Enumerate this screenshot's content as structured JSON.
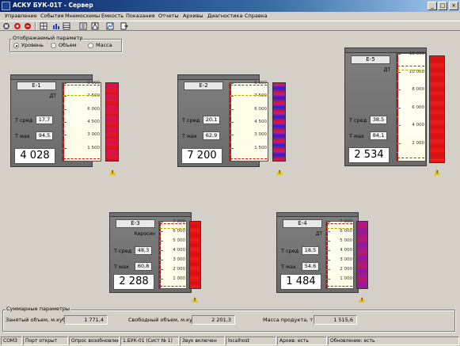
{
  "window": {
    "title": "АСКУ БУК-01Т - Сервер",
    "min": "_",
    "max": "□",
    "close": "×"
  },
  "menu": [
    "Управление",
    "События",
    "Мнемосхемы",
    "Емкость",
    "Показания",
    "Отчеты",
    "Архивы",
    "Диагностика",
    "Справка"
  ],
  "toolbar_icons": [
    "stop-icon",
    "alarm-icon",
    "reset-icon",
    "grid-icon",
    "bars-icon",
    "table-icon",
    "list-icon",
    "print-icon",
    "graph-icon",
    "export-icon"
  ],
  "param_group": {
    "title": "Отображаемый параметр",
    "options": [
      {
        "label": "Уровень",
        "selected": true
      },
      {
        "label": "Объем",
        "selected": false
      },
      {
        "label": "Масса",
        "selected": false
      }
    ]
  },
  "tanks": [
    {
      "name": "Е-1",
      "product": "ДТ",
      "t_avg_label": "T сред",
      "t_avg": "17,7",
      "t_max_label": "T мах",
      "t_max": "94,5",
      "value": "4 028",
      "ticks": [
        "9 000",
        "7 500",
        "6 000",
        "4 500",
        "3 000",
        "1 500"
      ],
      "scale_max": 9000,
      "level": 4028,
      "red_line": 8800,
      "yellow_line": 7600,
      "low_line": 300,
      "bar_style": "mixed",
      "warning": true
    },
    {
      "name": "Е-2",
      "product": "",
      "t_avg_label": "T сред",
      "t_avg": "20,1",
      "t_max_label": "T мах",
      "t_max": "62,9",
      "value": "7 200",
      "ticks": [
        "9 000",
        "7 500",
        "6 000",
        "4 500",
        "3 000",
        "1 500"
      ],
      "scale_max": 9000,
      "level": 7200,
      "red_line": 8800,
      "yellow_line": 7600,
      "low_line": 300,
      "bar_style": "blue",
      "warning": true
    },
    {
      "name": "Е-5",
      "product": "ДТ",
      "t_avg_label": "T сред",
      "t_avg": "38,5",
      "t_max_label": "T мах",
      "t_max": "84,1",
      "value": "2 534",
      "ticks": [
        "12 000",
        "10 000",
        "8 000",
        "6 000",
        "4 000",
        "2 000"
      ],
      "scale_max": 12000,
      "level": 2534,
      "red_line": 10700,
      "yellow_line": 10200,
      "low_line": 400,
      "bar_style": "red",
      "warning": true
    },
    {
      "name": "Е-3",
      "product": "Керосин",
      "t_avg_label": "T сред",
      "t_avg": "48,3",
      "t_max_label": "T мах",
      "t_max": "60,8",
      "value": "2 288",
      "ticks": [
        "7 000",
        "6 000",
        "5 000",
        "4 000",
        "3 000",
        "2 000",
        "1 000"
      ],
      "scale_max": 7000,
      "level": 2288,
      "red_line": 6800,
      "yellow_line": 6300,
      "low_line": 250,
      "bar_style": "red",
      "warning": true
    },
    {
      "name": "Е-4",
      "product": "ДТ",
      "t_avg_label": "T сред",
      "t_avg": "18,5",
      "t_max_label": "T мах",
      "t_max": "54,6",
      "value": "1 484",
      "ticks": [
        "7 000",
        "6 000",
        "5 000",
        "4 000",
        "3 000",
        "2 000",
        "1 000"
      ],
      "scale_max": 7000,
      "level": 1484,
      "red_line": 6800,
      "yellow_line": 6300,
      "low_line": 250,
      "bar_style": "purple",
      "warning": true
    }
  ],
  "summary": {
    "title": "Суммарные параметры",
    "occupied_label": "Занятый объем, м.куб",
    "occupied": "1 771,4",
    "free_label": "Свободный объем, м.куб",
    "free": "2 201,3",
    "mass_label": "Масса продукта, т",
    "mass": "1 515,6"
  },
  "status": [
    "COM3",
    "Порт открыт",
    "Опрос возобновлен",
    "1.БУК-01 (Сист № 1)",
    "Звук включен",
    "localhost",
    "Архив: есть",
    "Обновление: есть"
  ],
  "colors": {
    "accent_title": "#0a246a",
    "bar_red": "#e01818",
    "bar_blue": "#2a20c8",
    "bar_purple": "#8a1a9a",
    "warning": "#e8c000"
  }
}
